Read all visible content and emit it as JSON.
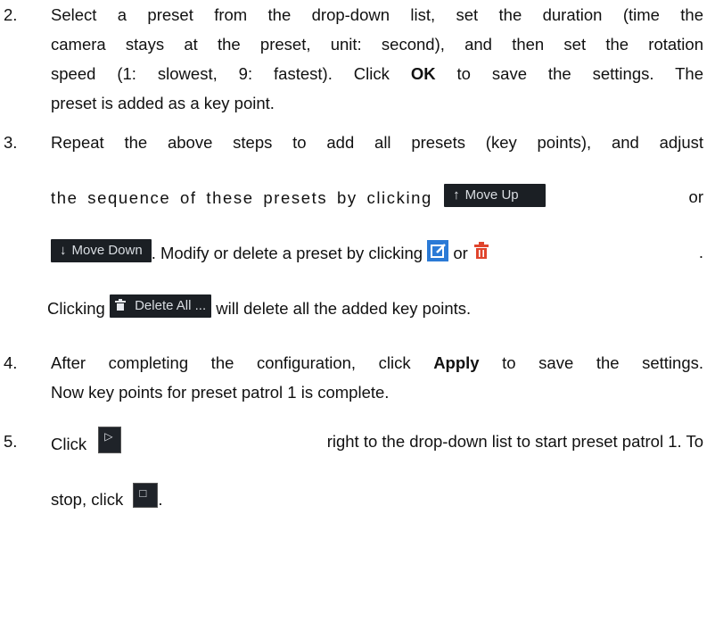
{
  "steps": [
    {
      "number": "2.",
      "lines": [
        "Select a preset from the drop-down list, set the duration (time the",
        "camera stays at the preset, unit: second), and then set the rotation",
        "speed (1: slowest, 9: fastest). Click",
        "OK",
        "to save the settings. The",
        "preset is added as a key point."
      ]
    },
    {
      "number": "3.",
      "line1": "Repeat the above steps to add all presets (key points), and adjust",
      "line2_pre": "the sequence of these presets by clicking",
      "line2_post": "or",
      "line3_post": ". Modify or delete a preset by clicking",
      "line3_or": "or",
      "line3_end": ".",
      "line4_pre": "Clicking",
      "line4_post": "will delete all the added key points."
    },
    {
      "number": "4.",
      "line1_pre": "After completing the configuration, click",
      "line1_bold": "Apply",
      "line1_post": "to save the settings.",
      "line2": "Now key points for preset patrol 1 is complete."
    },
    {
      "number": "5.",
      "line1_pre": "Click",
      "line1_post": "right to the drop-down list to start preset patrol 1. To",
      "line2_pre": "stop, click",
      "line2_post": "."
    }
  ],
  "buttons": {
    "move_up": "Move Up",
    "move_down": "Move Down",
    "delete_all": "Delete All ..."
  },
  "icons": {
    "arrow_up": "↑",
    "arrow_down": "↓",
    "play": "▷",
    "stop": "□"
  },
  "colors": {
    "edit_icon": "#2b7ad6",
    "delete_icon": "#e0442c",
    "button_bg": "#1b1f24"
  }
}
